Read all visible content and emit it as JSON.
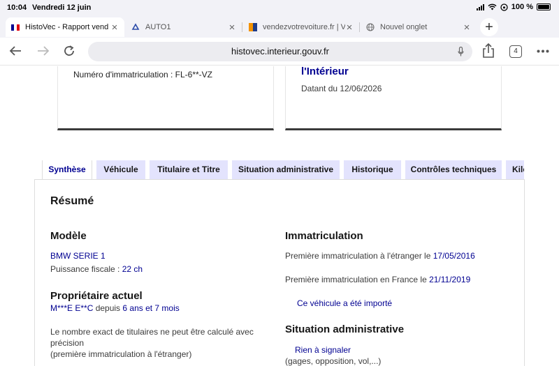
{
  "status": {
    "time": "10:04",
    "date": "Vendredi 12 juin",
    "battery": "100 %"
  },
  "browser_tabs": [
    {
      "title": "HistoVec - Rapport vend"
    },
    {
      "title": "AUTO1"
    },
    {
      "title": "vendezvotrevoiture.fr | V"
    },
    {
      "title": "Nouvel onglet"
    }
  ],
  "toolbar": {
    "url": "histovec.interieur.gouv.fr",
    "tab_count": "4"
  },
  "cards": {
    "left_line": "Numéro d'immatriculation : FL-6**-VZ",
    "right_heading": "l'Intérieur",
    "right_line": "Datant du 12/06/2026"
  },
  "page_tabs": [
    "Synthèse",
    "Véhicule",
    "Titulaire et Titre",
    "Situation administrative",
    "Historique",
    "Contrôles techniques",
    "Kilo"
  ],
  "summary": {
    "title": "Résumé",
    "model_heading": "Modèle",
    "model_name": "BMW SERIE 1",
    "fiscal_label": "Puissance fiscale : ",
    "fiscal_value": "22 ch",
    "owner_heading": "Propriétaire actuel",
    "owner_name": "M***E E**C",
    "owner_since_label": " depuis ",
    "owner_since_value": "6 ans et 7 mois",
    "owners_note_1": "Le nombre exact de titulaires ne peut être calculé avec",
    "owners_note_2": "précision",
    "owners_note_3": "(première immatriculation à l'étranger)",
    "registration_heading": "Immatriculation",
    "first_reg_abroad_label": "Première immatriculation à l'étranger le ",
    "first_reg_abroad_date": "17/05/2016",
    "first_reg_france_label": "Première immatriculation en France le ",
    "first_reg_france_date": "21/11/2019",
    "imported_link": "Ce véhicule a été importé",
    "admin_heading": "Situation administrative",
    "admin_link": "Rien à signaler",
    "admin_note": "(gages, opposition, vol,...)"
  },
  "colors": {
    "accent": "#000091",
    "tab_bg": "#e3e3fd"
  }
}
